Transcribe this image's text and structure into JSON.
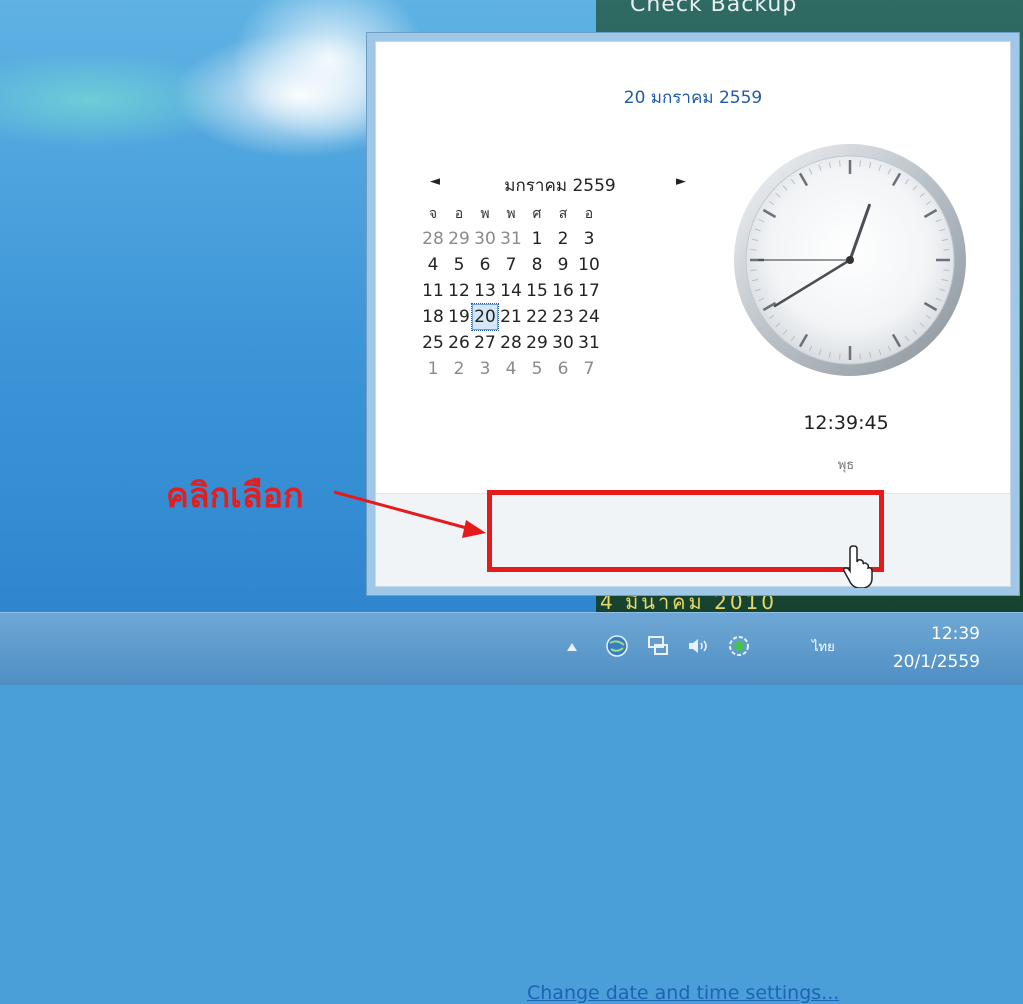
{
  "wallpaper": {
    "top_text": "Check Backup",
    "bottom_text": "4 มีนาคม 2010"
  },
  "annotation": {
    "label": "คลิกเลือก"
  },
  "flyout": {
    "header_date": "20 มกราคม 2559",
    "calendar": {
      "month_label": "มกราคม 2559",
      "prev_icon": "◄",
      "next_icon": "►",
      "weekdays": [
        "จ",
        "อ",
        "พ",
        "พ",
        "ศ",
        "ส",
        "อ"
      ],
      "weeks": [
        [
          "28",
          "29",
          "30",
          "31",
          "1",
          "2",
          "3"
        ],
        [
          "4",
          "5",
          "6",
          "7",
          "8",
          "9",
          "10"
        ],
        [
          "11",
          "12",
          "13",
          "14",
          "15",
          "16",
          "17"
        ],
        [
          "18",
          "19",
          "20",
          "21",
          "22",
          "23",
          "24"
        ],
        [
          "25",
          "26",
          "27",
          "28",
          "29",
          "30",
          "31"
        ],
        [
          "1",
          "2",
          "3",
          "4",
          "5",
          "6",
          "7"
        ]
      ],
      "selected_day": "20"
    },
    "clock": {
      "time": "12:39:45",
      "day_name": "พุธ"
    },
    "settings_link": "Change date and time settings..."
  },
  "taskbar": {
    "language": "ไทย",
    "time": "12:39",
    "date": "20/1/2559"
  },
  "colors": {
    "annotation_red": "#e51a1a",
    "link_blue": "#1e63b4"
  }
}
